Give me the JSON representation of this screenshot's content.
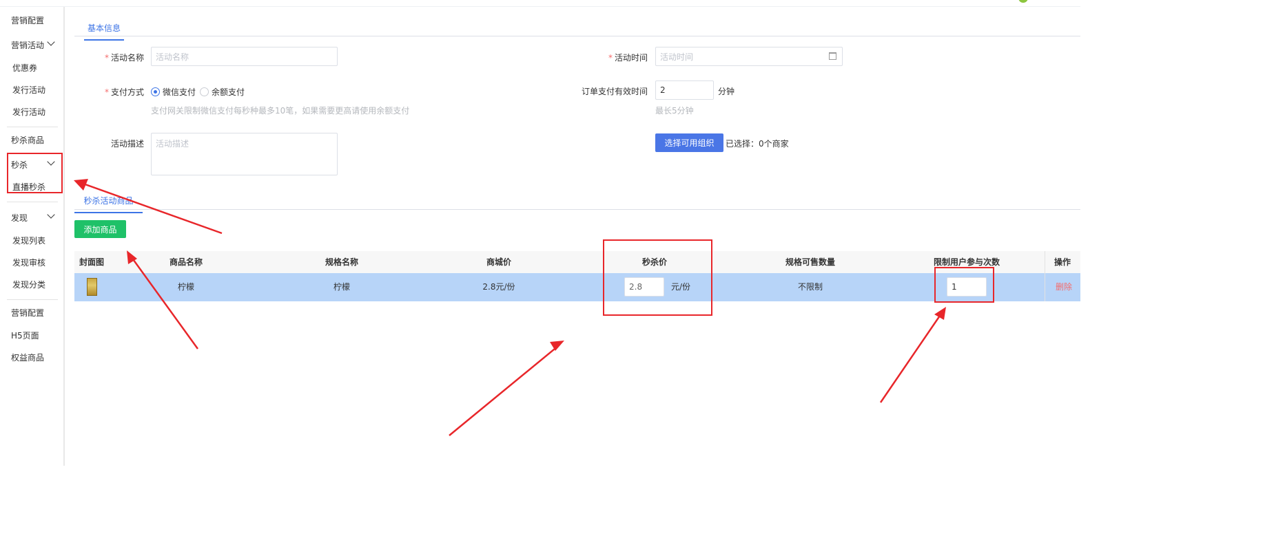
{
  "sidebar": {
    "items": [
      {
        "label": "营销配置"
      },
      {
        "label": "营销活动"
      },
      {
        "label": "优惠券"
      },
      {
        "label": "发行活动"
      },
      {
        "label": "发行活动"
      },
      {
        "label": "秒杀商品"
      },
      {
        "label": "秒杀"
      },
      {
        "label": "直播秒杀"
      },
      {
        "label": "发现"
      },
      {
        "label": "发现列表"
      },
      {
        "label": "发现审核"
      },
      {
        "label": "发现分类"
      },
      {
        "label": "营销配置"
      },
      {
        "label": "H5页面"
      },
      {
        "label": "权益商品"
      }
    ]
  },
  "tabs": {
    "basic": "基本信息",
    "seckill": "秒杀活动商品"
  },
  "form": {
    "required_mark": "*",
    "name_label": "活动名称",
    "name_placeholder": "活动名称",
    "time_label": "活动时间",
    "time_placeholder": "活动时间",
    "pay_label": "支付方式",
    "pay_options": [
      "微信支付",
      "余额支付"
    ],
    "pay_selected": "微信支付",
    "pay_hint": "支付网关限制微信支付每秒种最多10笔，如果需要更高请使用余额支付",
    "order_valid_label": "订单支付有效时间",
    "order_valid_value": "2",
    "order_valid_unit": "分钟",
    "order_valid_hint": "最长5分钟",
    "desc_label": "活动描述",
    "desc_placeholder": "活动描述",
    "select_org_button": "选择可用组织",
    "selected_text": "已选择：0个商家"
  },
  "add_product_button": "添加商品",
  "table": {
    "headers": [
      "封面图",
      "商品名称",
      "规格名称",
      "商城价",
      "秒杀价",
      "规格可售数量",
      "限制用户参与次数",
      "操作"
    ],
    "rows": [
      {
        "name": "柠檬",
        "spec": "柠檬",
        "mall_price": "2.8元/份",
        "seckill_price": "2.8",
        "seckill_unit": "元/份",
        "stock": "不限制",
        "limit": "1",
        "action": "删除"
      }
    ]
  },
  "colors": {
    "accent": "#3d74e6",
    "green": "#1fc168",
    "row_highlight": "#b7d4f8",
    "annotation_red": "#e8262a",
    "danger": "#f56c6c"
  }
}
